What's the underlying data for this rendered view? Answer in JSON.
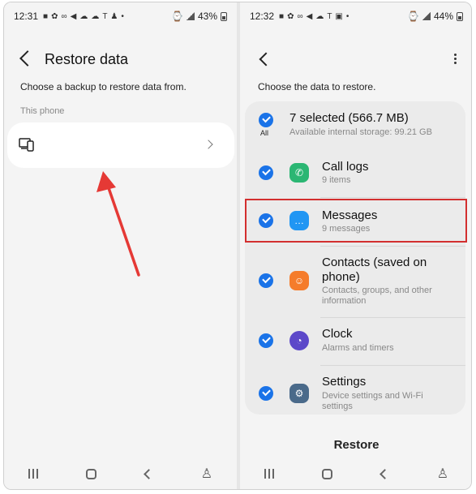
{
  "left": {
    "status": {
      "time": "12:31",
      "battery": "43%"
    },
    "title": "Restore data",
    "subtitle": "Choose a backup to restore data from.",
    "section_label": "This phone"
  },
  "right": {
    "status": {
      "time": "12:32",
      "battery": "44%"
    },
    "subtitle": "Choose the data to restore.",
    "summary": {
      "title": "7 selected (566.7 MB)",
      "sub": "Available internal storage: 99.21 GB",
      "all_label": "All"
    },
    "items": [
      {
        "title": "Call logs",
        "sub": "9 items",
        "color": "#2bb673",
        "icon": "phone-icon"
      },
      {
        "title": "Messages",
        "sub": "9 messages",
        "color": "#2196f3",
        "icon": "message-icon"
      },
      {
        "title": "Contacts (saved on phone)",
        "sub": "Contacts, groups, and other information",
        "color": "#f57c2b",
        "icon": "contact-icon"
      },
      {
        "title": "Clock",
        "sub": "Alarms and timers",
        "color": "#5c48c9",
        "icon": "clock-icon"
      },
      {
        "title": "Settings",
        "sub": "Device settings and Wi-Fi settings",
        "color": "#4a6a8a",
        "icon": "gear-icon"
      }
    ],
    "restore_label": "Restore"
  },
  "colors": {
    "accent": "#1a73e8",
    "highlight": "#d32f2f",
    "arrow": "#e53935"
  }
}
